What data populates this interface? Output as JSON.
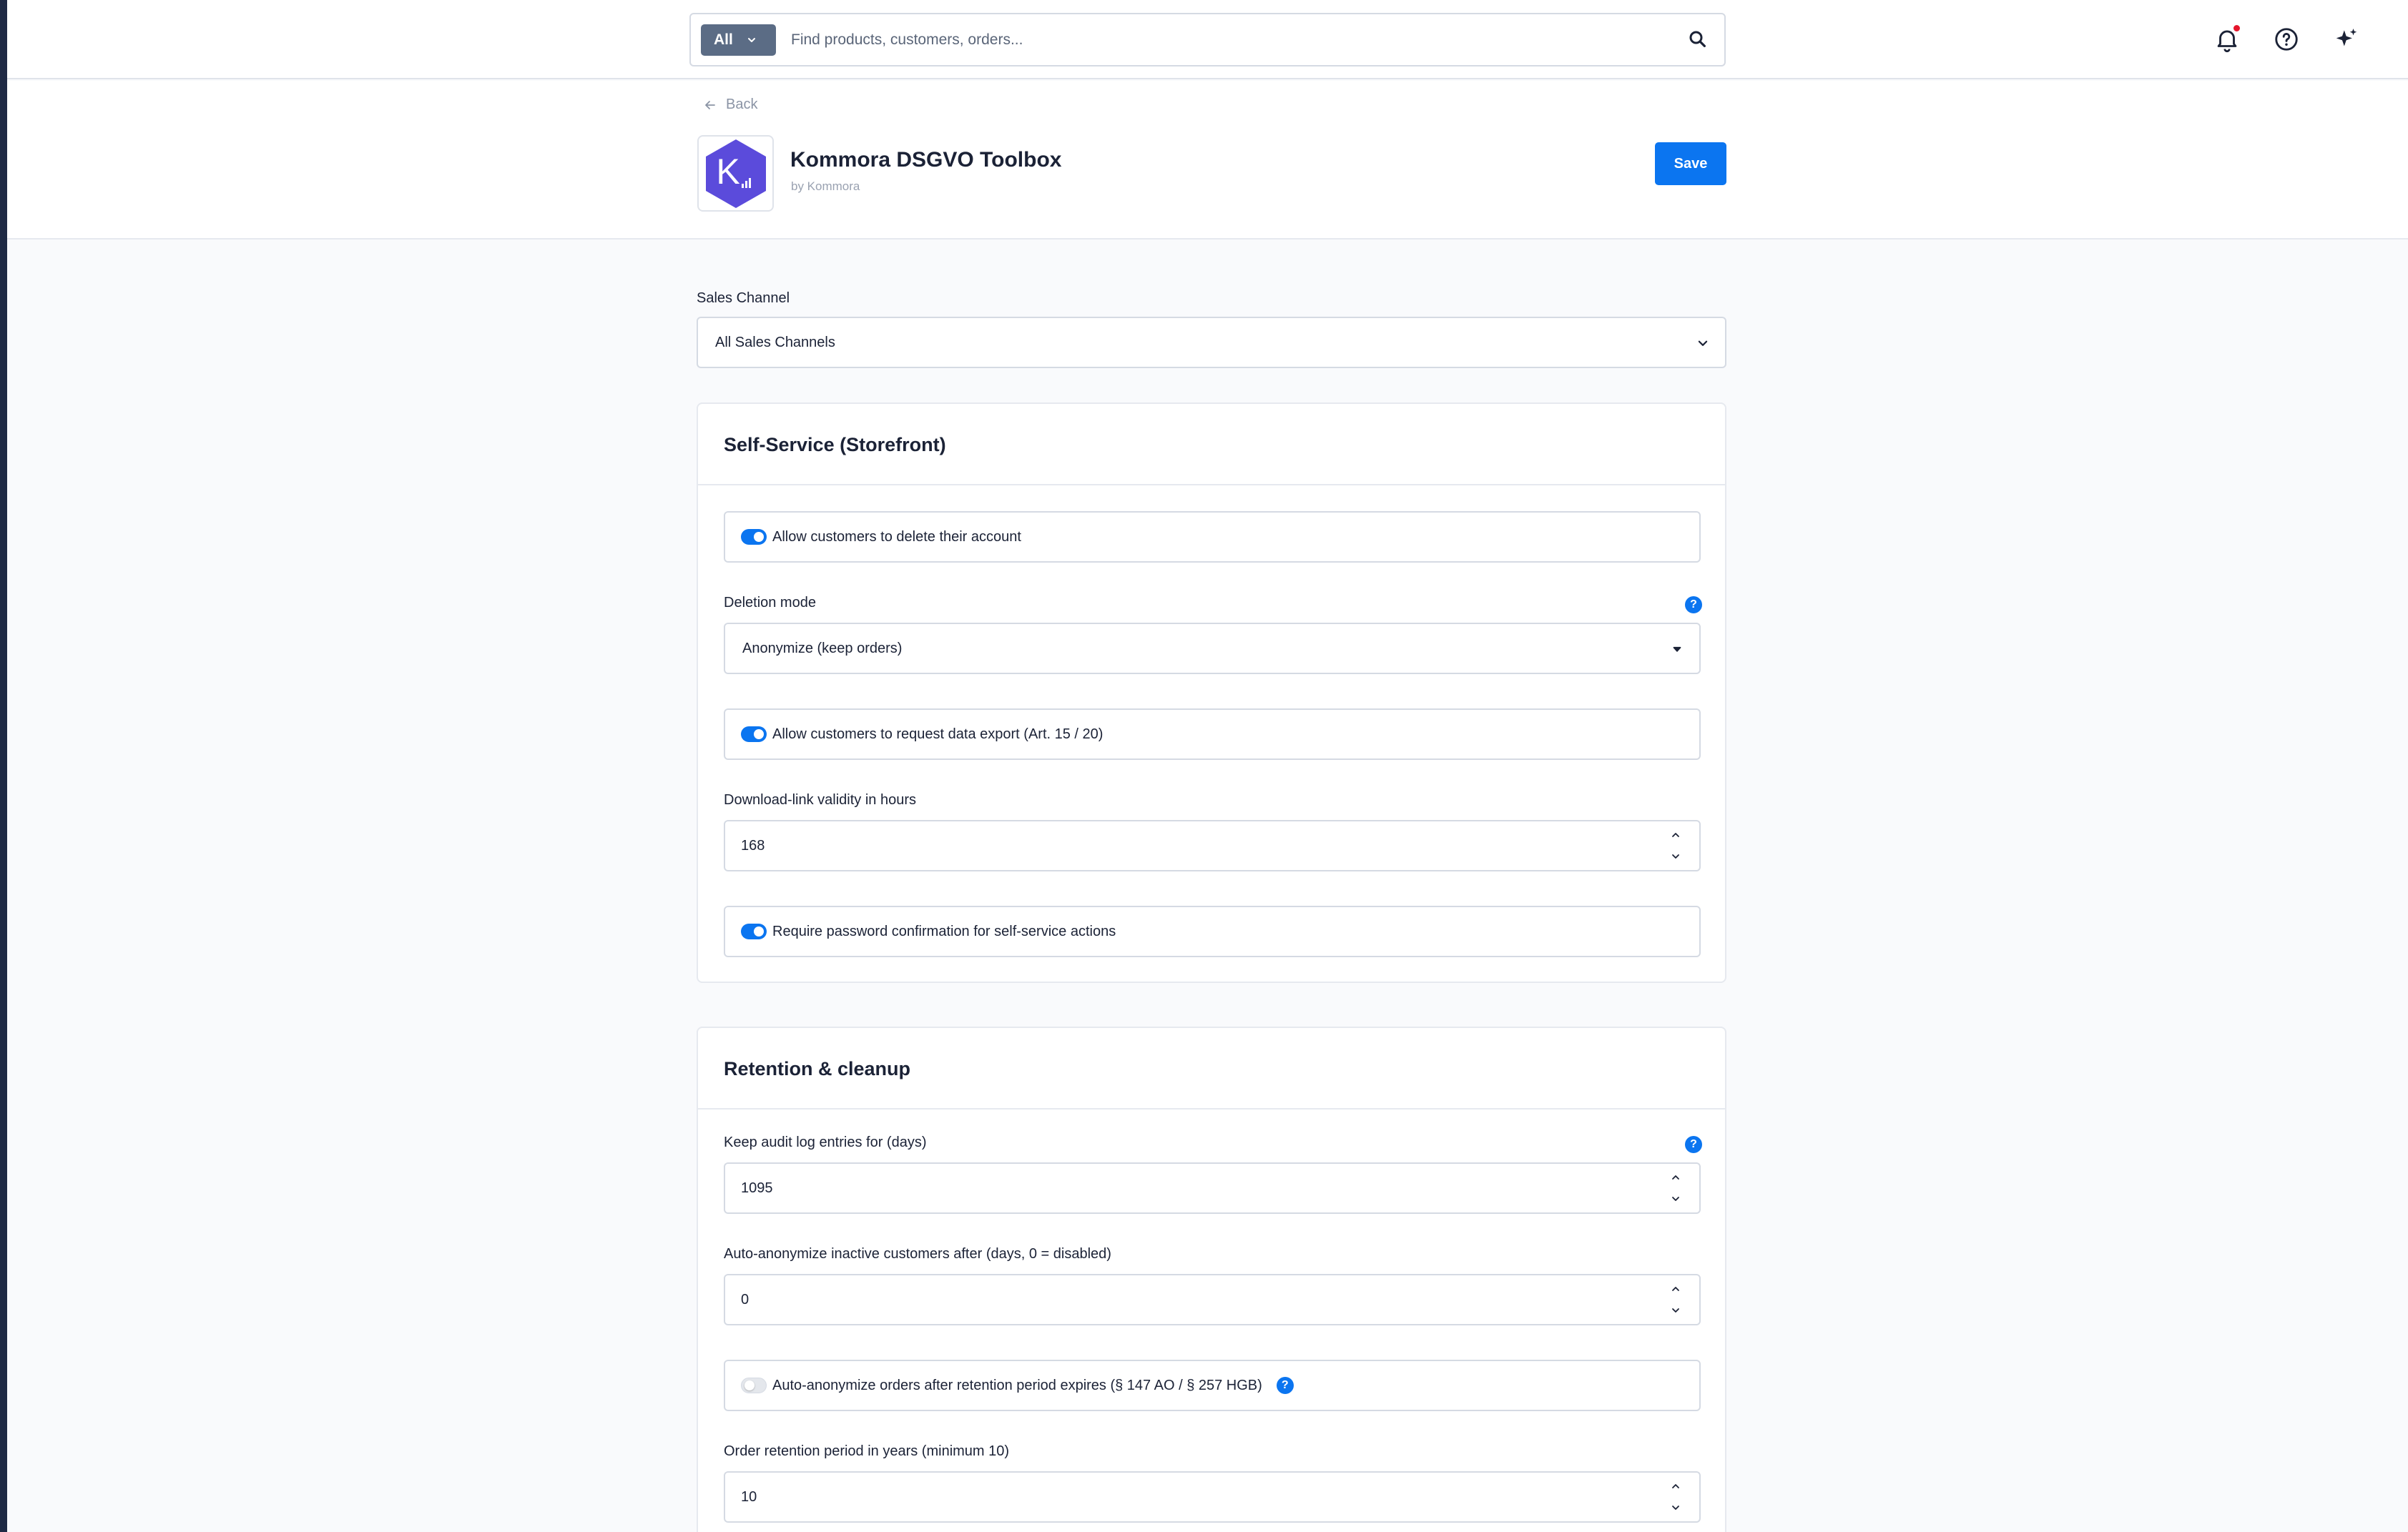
{
  "search": {
    "scope_label": "All",
    "placeholder": "Find products, customers, orders..."
  },
  "header": {
    "back_label": "Back",
    "app_title": "Kommora DSGVO Toolbox",
    "app_vendor": "by Kommora",
    "logo_letter": "K",
    "save_label": "Save"
  },
  "sales_channel": {
    "label": "Sales Channel",
    "selected": "All Sales Channels"
  },
  "self_service": {
    "title": "Self-Service (Storefront)",
    "allow_delete": {
      "label": "Allow customers to delete their account",
      "enabled": true
    },
    "deletion_mode": {
      "label": "Deletion mode",
      "selected": "Anonymize (keep orders)"
    },
    "allow_export": {
      "label": "Allow customers to request data export (Art. 15 / 20)",
      "enabled": true
    },
    "download_validity": {
      "label": "Download-link validity in hours",
      "value": "168"
    },
    "require_password": {
      "label": "Require password confirmation for self-service actions",
      "enabled": true
    }
  },
  "retention": {
    "title": "Retention & cleanup",
    "audit_log_days": {
      "label": "Keep audit log entries for (days)",
      "value": "1095"
    },
    "auto_anonymize_inactive": {
      "label": "Auto-anonymize inactive customers after (days, 0 = disabled)",
      "value": "0"
    },
    "auto_anonymize_orders": {
      "label": "Auto-anonymize orders after retention period expires (§ 147 AO / § 257 HGB)",
      "enabled": false
    },
    "order_retention_years": {
      "label": "Order retention period in years (minimum 10)",
      "value": "10"
    }
  },
  "help_glyph": "?",
  "colors": {
    "accent": "#0b75f0",
    "scope_chip": "#5b6c85",
    "logo_hex": "#5b4bdb",
    "notification_dot": "#e5152b",
    "left_rail": "#1f2a44"
  },
  "icons": [
    "bell-icon",
    "help-circle-icon",
    "sparkle-icon",
    "search-icon",
    "arrow-left-icon",
    "chevron-down-icon",
    "chevron-up-icon",
    "question-icon"
  ]
}
